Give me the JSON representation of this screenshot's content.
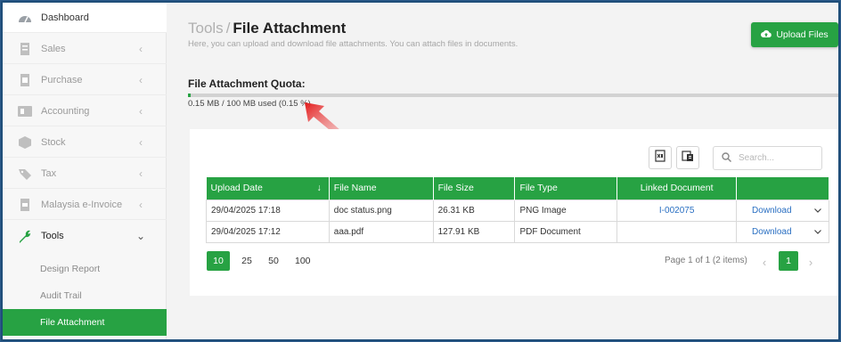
{
  "sidebar": {
    "items": [
      {
        "label": "Dashboard",
        "icon": "dashboard-icon"
      },
      {
        "label": "Sales",
        "icon": "sales-icon"
      },
      {
        "label": "Purchase",
        "icon": "purchase-icon"
      },
      {
        "label": "Accounting",
        "icon": "accounting-icon"
      },
      {
        "label": "Stock",
        "icon": "stock-icon"
      },
      {
        "label": "Tax",
        "icon": "tax-icon"
      },
      {
        "label": "Malaysia e-Invoice",
        "icon": "einvoice-icon"
      },
      {
        "label": "Tools",
        "icon": "wrench-icon"
      }
    ],
    "tools_sub": [
      {
        "label": "Design Report"
      },
      {
        "label": "Audit Trail"
      },
      {
        "label": "File Attachment"
      }
    ]
  },
  "header": {
    "breadcrumb_parent": "Tools",
    "separator": "/",
    "title": "File Attachment",
    "subtitle": "Here, you can upload and download file attachments. You can attach files in documents.",
    "upload_label": "Upload Files"
  },
  "quota": {
    "label": "File Attachment Quota:",
    "text": "0.15 MB / 100 MB used (0.15 %)",
    "fraction": 0.0015
  },
  "search": {
    "placeholder": "Search..."
  },
  "table": {
    "headers": [
      "Upload Date",
      "File Name",
      "File Size",
      "File Type",
      "Linked Document",
      ""
    ],
    "rows": [
      {
        "date": "29/04/2025 17:18",
        "name": "doc status.png",
        "size": "26.31 KB",
        "type": "PNG Image",
        "linked": "I-002075",
        "action": "Download"
      },
      {
        "date": "29/04/2025 17:12",
        "name": "aaa.pdf",
        "size": "127.91 KB",
        "type": "PDF Document",
        "linked": "",
        "action": "Download"
      }
    ]
  },
  "pager": {
    "sizes": [
      "10",
      "25",
      "50",
      "100"
    ],
    "info": "Page 1 of 1 (2 items)",
    "current": "1"
  },
  "colors": {
    "accent": "#27a243",
    "link": "#2a6fc2",
    "arrow": "#e02020"
  }
}
